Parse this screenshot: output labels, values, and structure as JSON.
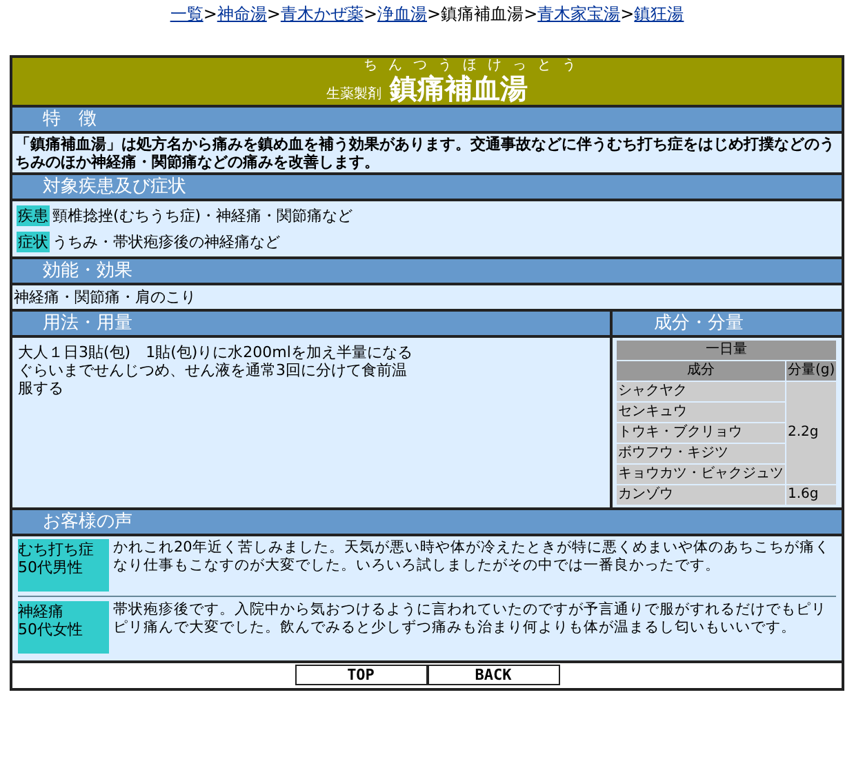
{
  "breadcrumb": [
    {
      "label": "一覧",
      "current": false
    },
    {
      "label": "神命湯",
      "current": false
    },
    {
      "label": "青木かぜ薬",
      "current": false
    },
    {
      "label": "浄血湯",
      "current": false
    },
    {
      "label": "鎮痛補血湯",
      "current": true
    },
    {
      "label": "青木家宝湯",
      "current": false
    },
    {
      "label": "鎮狂湯",
      "current": false
    }
  ],
  "separator": ">",
  "title": {
    "prefix": "生薬製剤",
    "name": "鎮痛補血湯",
    "reading": "ちんつうほけっとう"
  },
  "features": {
    "heading": "特　徴",
    "text": "「鎮痛補血湯」は処方名から痛みを鎮め血を補う効果があります。交通事故などに伴うむち打ち症をはじめ打撲などのうちみのほか神経痛・関節痛などの痛みを改善します。"
  },
  "targets": {
    "heading": "対象疾患及び症状",
    "items": [
      {
        "tag": "疾患",
        "text": "頸椎捻挫(むちうち症)・神経痛・関節痛など"
      },
      {
        "tag": "症状",
        "text": "うちみ・帯状疱疹後の神経痛など"
      }
    ]
  },
  "effects": {
    "heading": "効能・効果",
    "text": "神経痛・関節痛・肩のこり"
  },
  "dosage": {
    "heading": "用法・用量",
    "text": "大人１日3貼(包)　1貼(包)りに水200mlを加え半量になるぐらいまでせんじつめ、せん液を通常3回に分けて食前温服する"
  },
  "ingredients": {
    "heading": "成分・分量",
    "caption": "一日量",
    "columns": [
      "成分",
      "分量(g)"
    ],
    "groups": [
      {
        "amount": "2.2g",
        "items": [
          "シャクヤク",
          "センキュウ",
          "トウキ・ブクリョウ",
          "ボウフウ・キジツ",
          "キョウカツ・ビャクジュツ"
        ]
      },
      {
        "amount": "1.6g",
        "items": [
          "カンゾウ"
        ]
      }
    ]
  },
  "voices": {
    "heading": "お客様の声",
    "items": [
      {
        "who": "むち打ち症",
        "age": "50代男性",
        "text": "かれこれ20年近く苦しみました。天気が悪い時や体が冷えたときが特に悪くめまいや体のあちこちが痛くなり仕事もこなすのが大変でした。いろいろ試しましたがその中では一番良かったです。"
      },
      {
        "who": "神経痛",
        "age": "50代女性",
        "text": "帯状疱疹後です。入院中から気おつけるように言われていたのですが予言通りで服がすれるだけでもピリピリ痛んで大変でした。飲んでみると少しずつ痛みも治まり何よりも体が温まるし匂いもいいです。"
      }
    ]
  },
  "buttons": [
    "TOP",
    "BACK"
  ]
}
